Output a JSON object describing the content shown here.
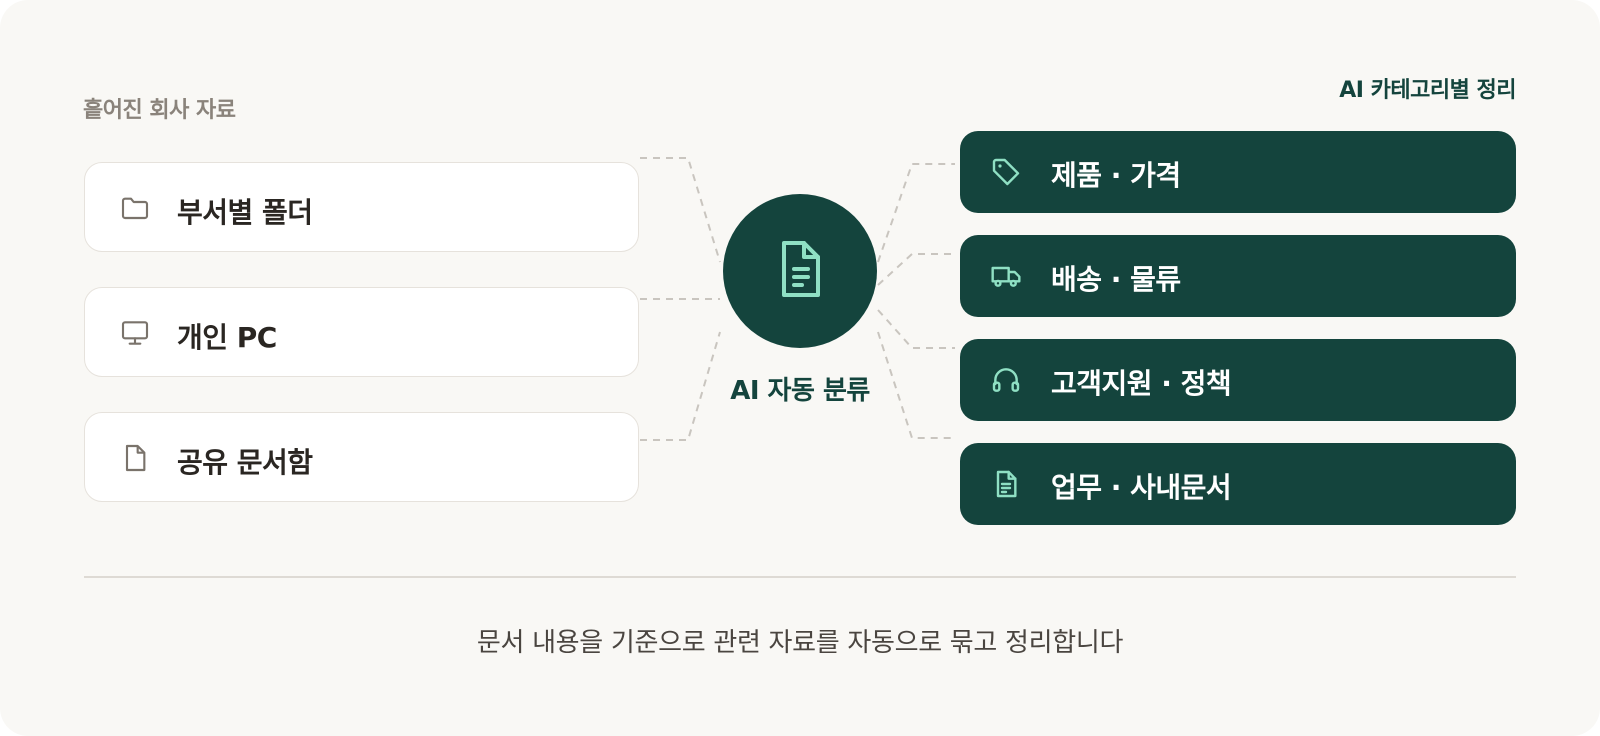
{
  "left_heading": "흩어진 회사 자료",
  "right_heading": "AI 카테고리별 정리",
  "hub_label": "AI 자동 분류",
  "hub_icon": "document-icon",
  "sources": [
    {
      "label": "부서별 폴더",
      "icon": "folder-icon"
    },
    {
      "label": "개인 PC",
      "icon": "monitor-icon"
    },
    {
      "label": "공유 문서함",
      "icon": "file-icon"
    }
  ],
  "categories": [
    {
      "label": "제품 · 가격",
      "icon": "tag-icon"
    },
    {
      "label": "배송 · 물류",
      "icon": "truck-icon"
    },
    {
      "label": "고객지원 · 정책",
      "icon": "headphones-icon"
    },
    {
      "label": "업무 · 사내문서",
      "icon": "document-icon"
    }
  ],
  "footer_text": "문서 내용을 기준으로 관련 자료를 자동으로 묶고 정리합니다",
  "colors": {
    "primary": "#14443d",
    "accent": "#8fe0c4",
    "background": "#f9f8f5",
    "card_border": "#e6e2dc",
    "muted_text": "#8a837b",
    "connector": "#c9c5bf"
  }
}
